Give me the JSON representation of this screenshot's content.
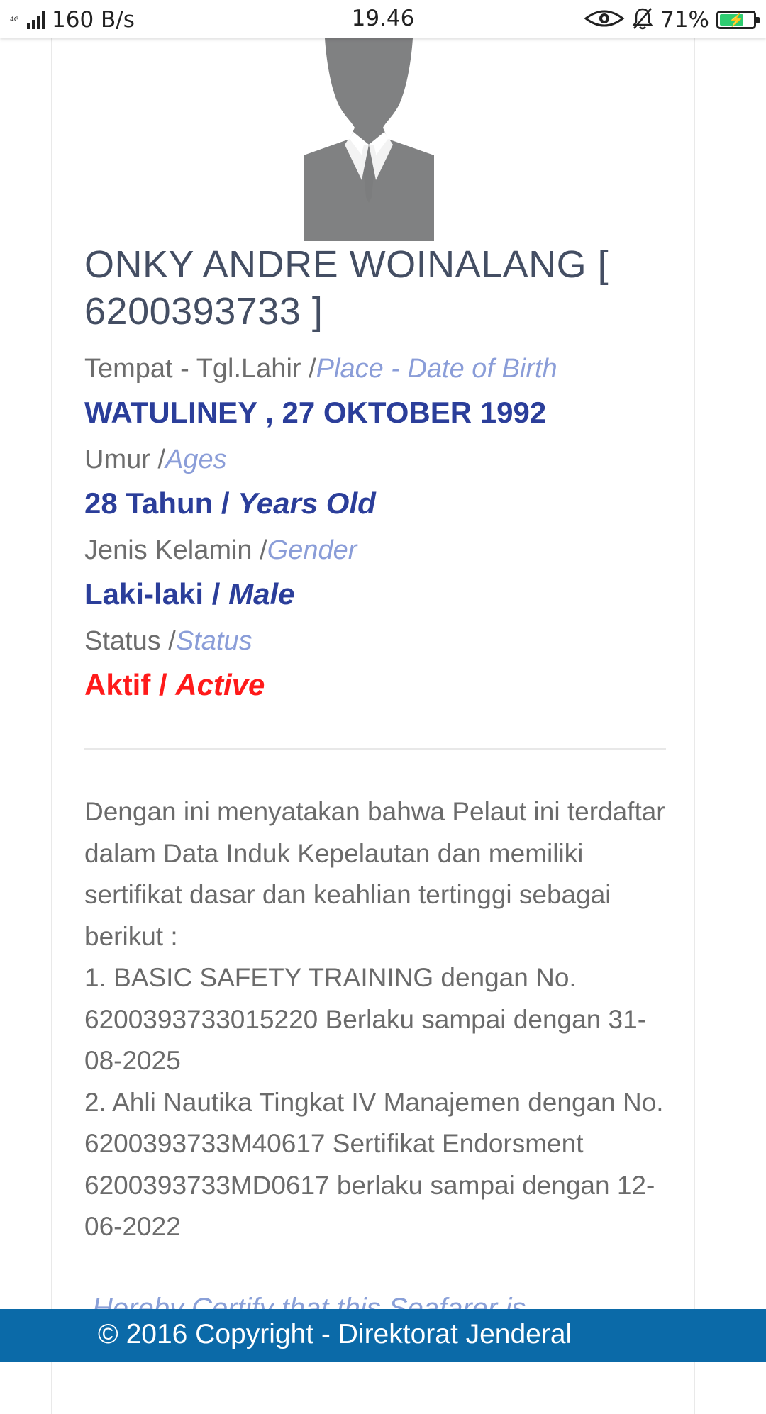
{
  "status_bar": {
    "network": "4G",
    "speed": "160 B/s",
    "time": "19.46",
    "battery": "71%",
    "battery_level": 0.71,
    "icons": [
      "signal-icon",
      "eye-icon",
      "bell-off-icon",
      "battery-charging-icon"
    ]
  },
  "profile": {
    "name": "ONKY ANDRE WOINALANG [ 6200393733 ]",
    "fields": [
      {
        "label": "Tempat - Tgl.Lahir /",
        "label_en": "Place - Date of Birth",
        "value": "WATULINEY , 27 OKTOBER 1992",
        "value_en": ""
      },
      {
        "label": "Umur /",
        "label_en": "Ages",
        "value": "28 Tahun / ",
        "value_en": "Years Old"
      },
      {
        "label": "Jenis Kelamin /",
        "label_en": "Gender",
        "value": "Laki-laki / ",
        "value_en": "Male"
      },
      {
        "label": "Status /",
        "label_en": "Status",
        "value": "Aktif / ",
        "value_en": "Active"
      }
    ]
  },
  "statement": {
    "intro": "Dengan ini menyatakan bahwa Pelaut ini terdaftar dalam Data Induk Kepelautan dan memiliki sertifikat dasar dan keahlian tertinggi sebagai berikut :",
    "cert1": "1.  BASIC SAFETY TRAINING dengan No. 6200393733015220 Berlaku sampai dengan 31-08-2025",
    "cert2": "2.  Ahli Nautika Tingkat IV Manajemen dengan No. 6200393733M40617 Sertifikat Endorsment 6200393733MD0617 berlaku sampai dengan 12-06-2022",
    "english_partial": "Hereby Certify that this Seafarer is"
  },
  "footer": {
    "text": "© 2016  Copyright - Direktorat Jenderal"
  },
  "colors": {
    "footer_bg": "#0b6aa8",
    "value_blue": "#2b3e9a",
    "label_en": "#8a9dd8",
    "active_red": "#ff1a1a"
  }
}
